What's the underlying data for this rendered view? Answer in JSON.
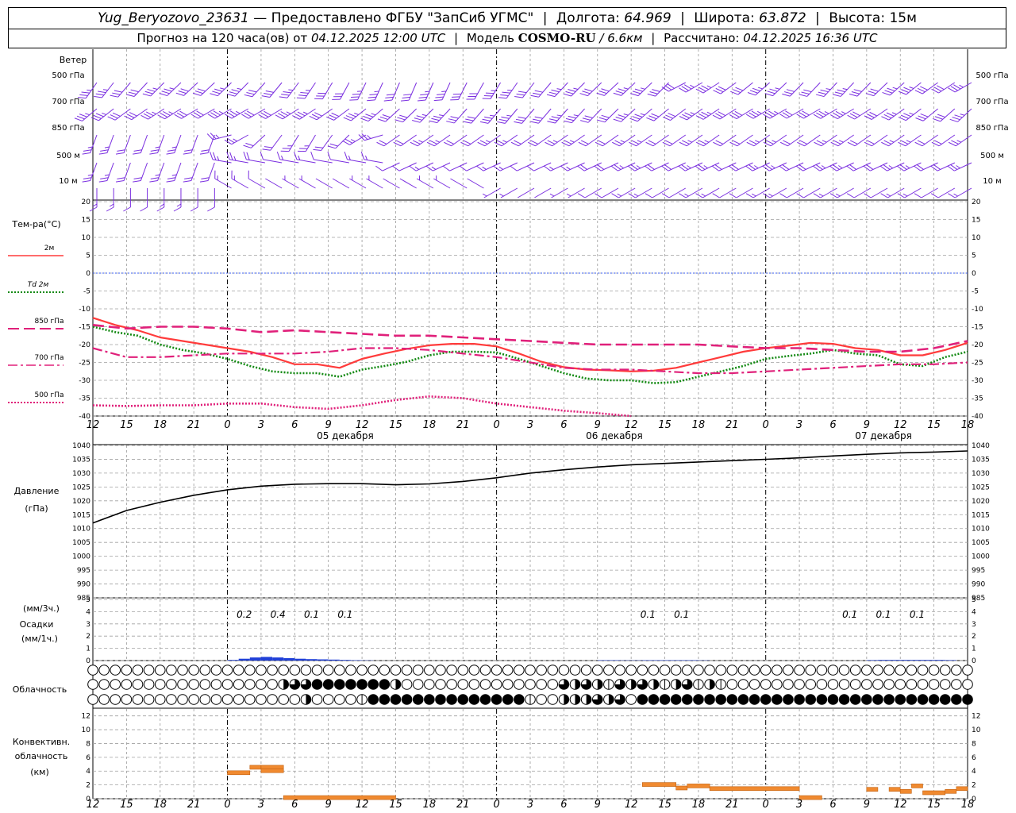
{
  "header": {
    "station": "Yug_Beryozovo_23631",
    "dash": "—",
    "provider": "Предоставлено ФГБУ \"ЗапСиб УГМС\"",
    "lon_label": "Долгота:",
    "lon_value": "64.969",
    "lat_label": "Широта:",
    "lat_value": "63.872",
    "alt_label": "Высота:",
    "alt_value": "15м",
    "forecast_prefix": "Прогноз на 120 часа(ов) от",
    "forecast_time": "04.12.2025 12:00 UTC",
    "model_label": "Модель",
    "model_name": "COSMO-RU",
    "model_res": "/ 6.6км",
    "calc_label": "Рассчитано:",
    "calc_time": "04.12.2025 16:36 UTC"
  },
  "axis": {
    "hour_ticks": [
      "12",
      "15",
      "18",
      "21",
      "0",
      "3",
      "6",
      "9",
      "12",
      "15",
      "18",
      "21",
      "0",
      "3",
      "6",
      "9",
      "12",
      "15",
      "18",
      "21",
      "0",
      "3",
      "6",
      "9",
      "12",
      "15",
      "18"
    ],
    "dates": [
      "05 декабря",
      "06 декабря",
      "07 декабря"
    ]
  },
  "wind_panel": {
    "title": "Ветер",
    "levels": [
      "500 гПа",
      "700 гПа",
      "850 гПа",
      "500 м",
      "10  м"
    ],
    "color": "#7a2ee0"
  },
  "temp_panel": {
    "title": "Тем-ра(°C)",
    "legend": [
      {
        "label": "2м",
        "color": "#ff3b3b",
        "style": "solid"
      },
      {
        "label": "Td  2м",
        "color": "#138a13",
        "style": "dotted"
      },
      {
        "label": "850 гПа",
        "color": "#e0207a",
        "style": "longdash"
      },
      {
        "label": "700 гПа",
        "color": "#e0207a",
        "style": "dashdot"
      },
      {
        "label": "500 гПа",
        "color": "#e0207a",
        "style": "shortdot"
      }
    ],
    "y_ticks": [
      "20",
      "15",
      "10",
      "5",
      "0",
      "-5",
      "-10",
      "-15",
      "-20",
      "-25",
      "-30",
      "-35",
      "-40"
    ]
  },
  "pressure_panel": {
    "title": "Давление",
    "unit": "(гПа)",
    "y_ticks": [
      "1040",
      "1035",
      "1030",
      "1025",
      "1020",
      "1015",
      "1010",
      "1005",
      "1000",
      "995",
      "990",
      "985"
    ]
  },
  "precip_panel": {
    "unit_3h": "(мм/3ч.)",
    "title": "Осадки",
    "unit_1h": "(мм/1ч.)",
    "y_ticks": [
      "5",
      "4",
      "3",
      "2",
      "1",
      "0"
    ],
    "labels": [
      {
        "h": 15,
        "text": "0.2"
      },
      {
        "h": 18,
        "text": "0.4"
      },
      {
        "h": 21,
        "text": "0.1"
      },
      {
        "h": 24,
        "text": "0.1"
      },
      {
        "h": 51,
        "text": "0.1"
      },
      {
        "h": 54,
        "text": "0.1"
      },
      {
        "h": 69,
        "text": "0.1"
      },
      {
        "h": 72,
        "text": "0.1"
      },
      {
        "h": 75,
        "text": "0.1"
      }
    ]
  },
  "cloud_panel": {
    "title": "Облачность"
  },
  "conv_panel": {
    "title1": "Конвективн.",
    "title2": "облачность",
    "unit": "(км)",
    "y_ticks": [
      "12",
      "10",
      "8",
      "6",
      "4",
      "2",
      "0"
    ]
  },
  "chart_data": {
    "type": "line",
    "x_unit": "hours since 04.12.2025 12:00 UTC",
    "x_range": [
      0,
      78
    ],
    "temperature": {
      "ylim": [
        -40,
        20
      ],
      "series": [
        {
          "name": "2м",
          "x": [
            0,
            2,
            4,
            6,
            8,
            10,
            12,
            14,
            16,
            18,
            20,
            22,
            24,
            26,
            28,
            30,
            32,
            34,
            36,
            38,
            40,
            42,
            44,
            46,
            48,
            50,
            52,
            54,
            56,
            58,
            60,
            62,
            64,
            66,
            68,
            70,
            72,
            74,
            76,
            78
          ],
          "values": [
            -12.5,
            -14.5,
            -16,
            -18,
            -19,
            -20,
            -21,
            -22,
            -23.5,
            -25.5,
            -25.5,
            -26.5,
            -24,
            -22.5,
            -21.2,
            -20.2,
            -19.8,
            -19.8,
            -20.5,
            -22.5,
            -24.8,
            -26.3,
            -27,
            -27.2,
            -27.5,
            -27.3,
            -26.5,
            -25,
            -23.5,
            -22,
            -21,
            -20.3,
            -19.5,
            -19.8,
            -21,
            -21.5,
            -23,
            -23,
            -21.5,
            -19.5
          ]
        },
        {
          "name": "Td  2м",
          "x": [
            0,
            2,
            4,
            6,
            8,
            10,
            12,
            14,
            16,
            18,
            20,
            22,
            24,
            26,
            28,
            30,
            32,
            34,
            36,
            38,
            40,
            42,
            44,
            46,
            48,
            50,
            52,
            54,
            56,
            58,
            60,
            62,
            64,
            66,
            68,
            70,
            72,
            74,
            76,
            78
          ],
          "values": [
            -15,
            -16.5,
            -17.5,
            -20,
            -21.5,
            -22.5,
            -24,
            -26,
            -27.5,
            -28,
            -28,
            -29,
            -27,
            -26,
            -24.8,
            -23,
            -22,
            -22,
            -22.2,
            -24,
            -26,
            -28,
            -29.5,
            -30,
            -30,
            -30.8,
            -30.5,
            -29,
            -27.5,
            -26,
            -24,
            -23.2,
            -22.5,
            -21.5,
            -22.5,
            -23,
            -25.5,
            -26,
            -23.5,
            -22
          ]
        },
        {
          "name": "850 гПа",
          "x": [
            0,
            3,
            6,
            9,
            12,
            15,
            18,
            21,
            24,
            27,
            30,
            33,
            36,
            39,
            42,
            45,
            48,
            51,
            54,
            57,
            60,
            63,
            66,
            69,
            72,
            75,
            78
          ],
          "values": [
            -14.5,
            -15.5,
            -15,
            -15,
            -15.5,
            -16.5,
            -16,
            -16.5,
            -17,
            -17.5,
            -17.5,
            -18,
            -18.5,
            -19,
            -19.5,
            -20,
            -20,
            -20,
            -20,
            -20.5,
            -21,
            -21,
            -21.5,
            -22,
            -22,
            -21,
            -19
          ]
        },
        {
          "name": "700 гПа",
          "x": [
            0,
            3,
            6,
            9,
            12,
            15,
            18,
            21,
            24,
            27,
            30,
            33,
            36,
            39,
            42,
            45,
            48,
            51,
            54,
            57,
            60,
            63,
            66,
            69,
            72,
            75,
            78
          ],
          "values": [
            -21,
            -23.5,
            -23.5,
            -23,
            -22.5,
            -22.5,
            -22.5,
            -22,
            -21,
            -21,
            -21.5,
            -22.5,
            -23.5,
            -25,
            -26.5,
            -27,
            -27,
            -27.5,
            -28,
            -28,
            -27.5,
            -27,
            -26.5,
            -26,
            -25.5,
            -25.5,
            -25
          ]
        },
        {
          "name": "500 гПа",
          "x": [
            0,
            3,
            6,
            9,
            12,
            15,
            18,
            21,
            24,
            27,
            30,
            33,
            36,
            39,
            42,
            45,
            48
          ],
          "values": [
            -37,
            -37.2,
            -37,
            -37,
            -36.5,
            -36.5,
            -37.5,
            -38,
            -37,
            -35.5,
            -34.5,
            -35,
            -36.5,
            -37.5,
            -38.5,
            -39.2,
            -40
          ]
        }
      ]
    },
    "pressure": {
      "ylim": [
        985,
        1040
      ],
      "x": [
        0,
        3,
        6,
        9,
        12,
        15,
        18,
        21,
        24,
        27,
        30,
        33,
        36,
        39,
        42,
        45,
        48,
        51,
        54,
        57,
        60,
        63,
        66,
        69,
        72,
        75,
        78
      ],
      "values": [
        1012,
        1016.5,
        1019.5,
        1022,
        1024,
        1025.3,
        1026,
        1026.2,
        1026.2,
        1025.8,
        1026.1,
        1027,
        1028.3,
        1030,
        1031.2,
        1032.2,
        1033,
        1033.5,
        1034,
        1034.5,
        1035,
        1035.5,
        1036.2,
        1036.8,
        1037.3,
        1037.6,
        1038
      ]
    },
    "precip_mm_per_1h": {
      "ylim": [
        0,
        5
      ],
      "x": [
        12,
        13,
        14,
        15,
        16,
        17,
        18,
        19,
        20,
        21,
        22,
        23,
        24,
        45,
        46,
        47,
        48,
        49,
        50,
        51,
        52,
        53,
        54,
        69,
        70,
        71,
        72,
        73,
        74,
        75,
        76
      ],
      "values": [
        0.05,
        0.15,
        0.25,
        0.3,
        0.25,
        0.2,
        0.15,
        0.12,
        0.1,
        0.08,
        0.05,
        0.03,
        0.02,
        0.03,
        0.03,
        0.02,
        0.02,
        0.03,
        0.03,
        0.03,
        0.03,
        0.03,
        0.02,
        0.04,
        0.05,
        0.05,
        0.05,
        0.05,
        0.05,
        0.05,
        0.04
      ]
    },
    "cloud_cover_octas": {
      "x_step": 1,
      "upper": "all clear",
      "middle_start_hour": 17,
      "lower_start_hour": 19
    },
    "convective_top_km": {
      "ylim": [
        0,
        13
      ],
      "segments": [
        {
          "from": 12,
          "to": 14,
          "value": 3.7
        },
        {
          "from": 14,
          "to": 15,
          "value": 4.5
        },
        {
          "from": 15,
          "to": 17,
          "value": 4.5
        },
        {
          "from": 15,
          "to": 17,
          "value": 4.0
        },
        {
          "from": 17,
          "to": 27,
          "value": 0.1
        },
        {
          "from": 49,
          "to": 52,
          "value": 2.0
        },
        {
          "from": 52,
          "to": 53,
          "value": 1.5
        },
        {
          "from": 53,
          "to": 55,
          "value": 1.8
        },
        {
          "from": 55,
          "to": 63,
          "value": 1.4
        },
        {
          "from": 63,
          "to": 65,
          "value": 0.1
        },
        {
          "from": 69,
          "to": 70,
          "value": 1.3
        },
        {
          "from": 71,
          "to": 72,
          "value": 1.3
        },
        {
          "from": 72,
          "to": 73,
          "value": 1.0
        },
        {
          "from": 73,
          "to": 74,
          "value": 1.8
        },
        {
          "from": 74,
          "to": 76,
          "value": 0.8
        },
        {
          "from": 76,
          "to": 77,
          "value": 1.0
        },
        {
          "from": 77,
          "to": 78,
          "value": 1.4
        }
      ]
    }
  }
}
